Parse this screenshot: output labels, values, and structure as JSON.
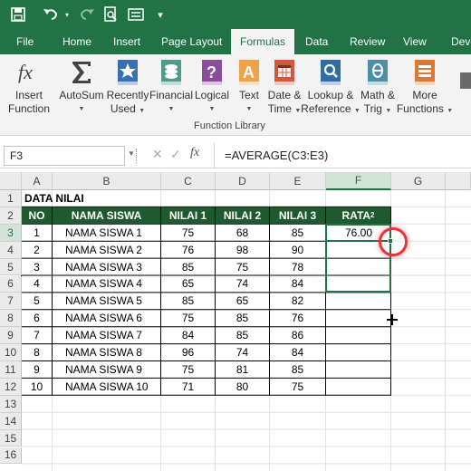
{
  "titlebar": {
    "icons": [
      "save-icon",
      "undo-icon",
      "redo-icon",
      "print-preview-icon",
      "form-icon",
      "customize-icon"
    ]
  },
  "tabs": [
    {
      "label": "File",
      "active": false
    },
    {
      "label": "Home",
      "active": false
    },
    {
      "label": "Insert",
      "active": false
    },
    {
      "label": "Page Layout",
      "active": false
    },
    {
      "label": "Formulas",
      "active": true
    },
    {
      "label": "Data",
      "active": false
    },
    {
      "label": "Review",
      "active": false
    },
    {
      "label": "View",
      "active": false
    },
    {
      "label": "Deve",
      "active": false
    }
  ],
  "ribbon": {
    "group_label": "Function Library",
    "buttons": [
      {
        "id": "insert-function",
        "line1": "Insert",
        "line2": "Function",
        "icon": "fx-icon",
        "caret": false
      },
      {
        "id": "autosum",
        "line1": "AutoSum",
        "line2": "",
        "icon": "sigma-icon",
        "caret": true
      },
      {
        "id": "recently-used",
        "line1": "Recently",
        "line2": "Used",
        "icon": "star-book-icon",
        "caret": true
      },
      {
        "id": "financial",
        "line1": "Financial",
        "line2": "",
        "icon": "coins-book-icon",
        "caret": true
      },
      {
        "id": "logical",
        "line1": "Logical",
        "line2": "",
        "icon": "question-book-icon",
        "caret": true
      },
      {
        "id": "text",
        "line1": "Text",
        "line2": "",
        "icon": "text-book-icon",
        "caret": true
      },
      {
        "id": "date-time",
        "line1": "Date &",
        "line2": "Time",
        "icon": "calendar-book-icon",
        "caret": true
      },
      {
        "id": "lookup-reference",
        "line1": "Lookup &",
        "line2": "Reference",
        "icon": "magnifier-book-icon",
        "caret": true
      },
      {
        "id": "math-trig",
        "line1": "Math &",
        "line2": "Trig",
        "icon": "theta-book-icon",
        "caret": true
      },
      {
        "id": "more-functions",
        "line1": "More",
        "line2": "Functions",
        "icon": "more-book-icon",
        "caret": true
      }
    ]
  },
  "formula_bar": {
    "name_box": "F3",
    "fx": "fx",
    "formula": "=AVERAGE(C3:E3)"
  },
  "sheet": {
    "columns": [
      "A",
      "B",
      "C",
      "D",
      "E",
      "F",
      "G"
    ],
    "rows": [
      "1",
      "2",
      "3",
      "4",
      "5",
      "6",
      "7",
      "8",
      "9",
      "10",
      "11",
      "12",
      "13",
      "14",
      "15",
      "16"
    ],
    "title": "DATA NILAI",
    "headers": [
      "NO",
      "NAMA SISWA",
      "NILAI 1",
      "NILAI 2",
      "NILAI 3",
      "RATA",
      "2"
    ],
    "data": [
      [
        "1",
        "NAMA SISWA 1",
        "75",
        "68",
        "85",
        "76.00"
      ],
      [
        "2",
        "NAMA SISWA 2",
        "76",
        "98",
        "90",
        ""
      ],
      [
        "3",
        "NAMA SISWA 3",
        "85",
        "75",
        "78",
        ""
      ],
      [
        "4",
        "NAMA SISWA 4",
        "65",
        "74",
        "84",
        ""
      ],
      [
        "5",
        "NAMA SISWA 5",
        "85",
        "65",
        "82",
        ""
      ],
      [
        "6",
        "NAMA SISWA 6",
        "75",
        "85",
        "76",
        ""
      ],
      [
        "7",
        "NAMA SISWA 7",
        "84",
        "85",
        "86",
        ""
      ],
      [
        "8",
        "NAMA SISWA 8",
        "96",
        "74",
        "84",
        ""
      ],
      [
        "9",
        "NAMA SISWA 9",
        "75",
        "81",
        "85",
        ""
      ],
      [
        "10",
        "NAMA SISWA 10",
        "71",
        "80",
        "75",
        ""
      ]
    ],
    "selected_cell": "F3",
    "accent": "#217346",
    "header_fill": "#1e5a2d",
    "highlight_color": "#e8323c"
  }
}
